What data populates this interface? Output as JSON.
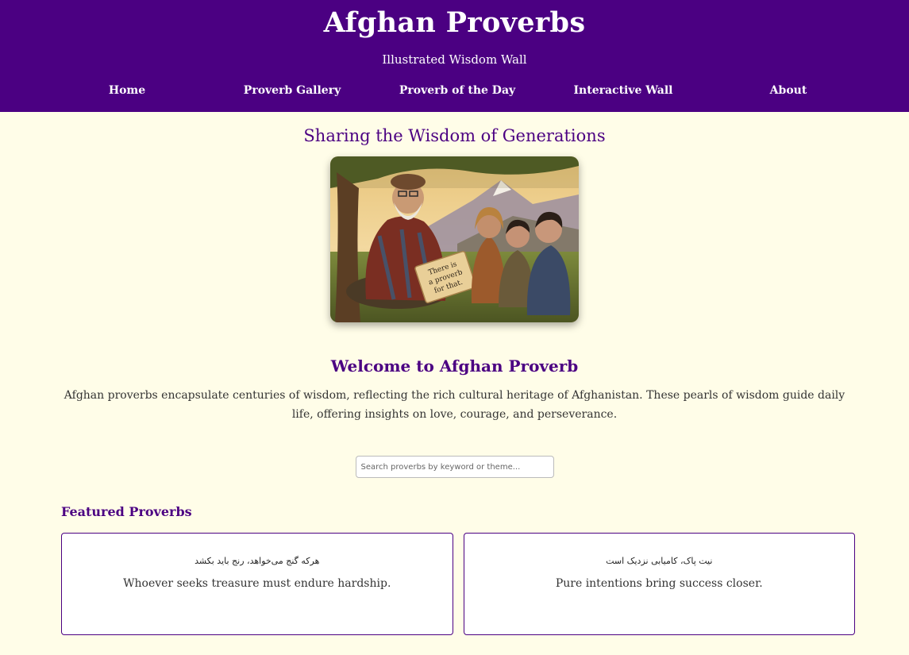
{
  "header": {
    "title": "Afghan Proverbs",
    "subtitle": "Illustrated Wisdom Wall"
  },
  "nav": {
    "items": [
      {
        "label": "Home"
      },
      {
        "label": "Proverb Gallery"
      },
      {
        "label": "Proverb of the Day"
      },
      {
        "label": "Interactive Wall"
      },
      {
        "label": "About"
      }
    ]
  },
  "hero": {
    "heading": "Sharing the Wisdom of Generations",
    "scroll_text": [
      "There is",
      "a proverb",
      "for that."
    ]
  },
  "welcome": {
    "title": "Welcome to Afghan Proverb",
    "text": "Afghan proverbs encapsulate centuries of wisdom, reflecting the rich cultural heritage of Afghanistan. These pearls of wisdom guide daily life, offering insights on love, courage, and perseverance."
  },
  "search": {
    "placeholder": "Search proverbs by keyword or theme...",
    "value": ""
  },
  "featured": {
    "title": "Featured Proverbs",
    "cards": [
      {
        "original": "هرکه گنج می‌خواهد، رنج باید بکشد",
        "translation": "Whoever seeks treasure must endure hardship."
      },
      {
        "original": "نیت پاک، کامیابی نزدیک است",
        "translation": "Pure intentions bring success closer."
      }
    ]
  },
  "colors": {
    "brand": "#4b0082",
    "background": "#fffde8",
    "card_background": "#ffffff"
  }
}
